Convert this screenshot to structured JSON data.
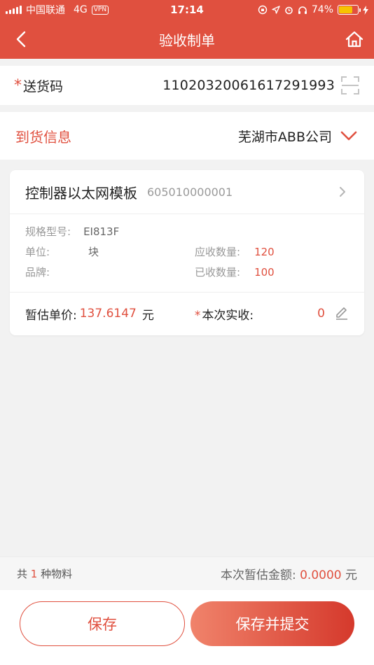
{
  "status_bar": {
    "carrier": "中国联通",
    "network": "4G",
    "vpn": "VPN",
    "time": "17:14",
    "battery": "74%"
  },
  "nav": {
    "title": "验收制单"
  },
  "delivery": {
    "required_mark": "*",
    "label": "送货码",
    "value": "11020320061617291993"
  },
  "arrival": {
    "label": "到货信息",
    "company": "芜湖市ABB公司"
  },
  "item": {
    "name": "控制器以太网模板",
    "code": "605010000001",
    "spec_label": "规格型号:",
    "spec_value": "EI813F",
    "unit_label": "单位:",
    "unit_value": "块",
    "due_label": "应收数量:",
    "due_value": "120",
    "brand_label": "品牌:",
    "brand_value": "",
    "received_label": "已收数量:",
    "received_value": "100",
    "price_label": "暂估单价:",
    "price_value": "137.6147",
    "price_unit": "元",
    "actual_required": "*",
    "actual_label": "本次实收:",
    "actual_value": "0"
  },
  "summary": {
    "count_prefix": "共",
    "count": "1",
    "count_suffix": "种物料",
    "amount_label": "本次暂估金额:",
    "amount_value": "0.0000",
    "amount_unit": "元"
  },
  "buttons": {
    "save": "保存",
    "submit": "保存并提交"
  },
  "colors": {
    "brand": "#e0503f",
    "background": "#f2f2f2",
    "battery": "#f7c300"
  },
  "icons": [
    "back-arrow-icon",
    "home-icon",
    "scan-icon",
    "chevron-down-icon",
    "chevron-right-icon",
    "edit-pencil-icon"
  ]
}
